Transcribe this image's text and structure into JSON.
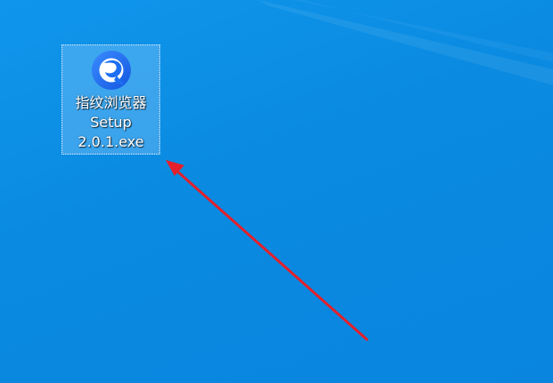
{
  "desktop": {
    "icon": {
      "name": "指纹浏览器 Setup 2.0.1.exe",
      "label_lines": [
        "指纹浏览器",
        "Setup",
        "2.0.1.exe"
      ],
      "icon_name": "fingerprint-browser-app-icon",
      "accent_color": "#1c6ff2",
      "selected": true
    },
    "background_color": "#0a8ae0"
  },
  "annotation": {
    "type": "arrow",
    "color": "#e3202b",
    "points_to": "desktop-icon"
  }
}
